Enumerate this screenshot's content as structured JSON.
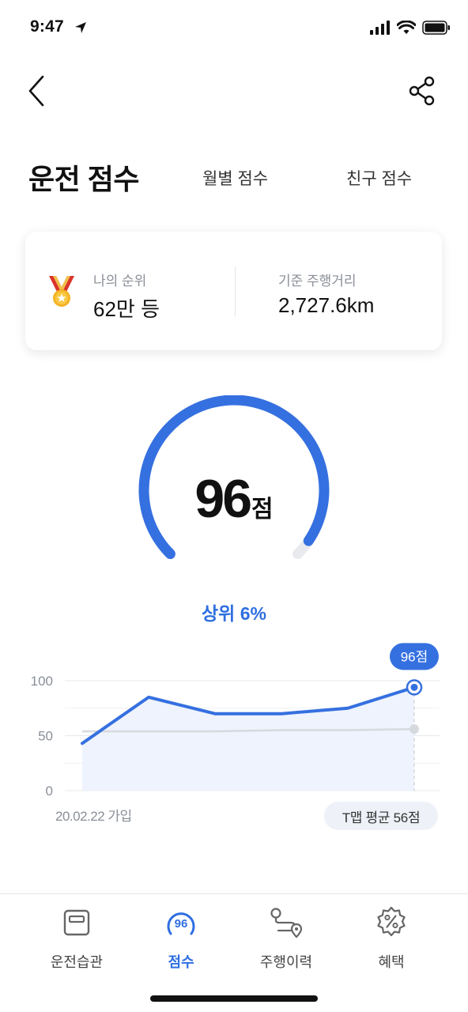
{
  "status": {
    "time": "9:47"
  },
  "tabs": {
    "active": "운전 점수",
    "monthly": "월별 점수",
    "friends": "친구 점수"
  },
  "rank_card": {
    "rank_label": "나의 순위",
    "rank_value": "62만 등",
    "distance_label": "기준 주행거리",
    "distance_value": "2,727.6km"
  },
  "score": {
    "value": "96",
    "unit": "점",
    "gauge_fraction": 0.96,
    "rank_percent": "상위 6%"
  },
  "chart_data": {
    "type": "line",
    "ylim": [
      0,
      100
    ],
    "y_ticks": [
      "100",
      "50",
      "0"
    ],
    "series": [
      {
        "values": [
          43,
          85,
          70,
          70,
          75,
          94
        ],
        "color": "#3570e0"
      },
      {
        "values": [
          54,
          54,
          54,
          55,
          55,
          56
        ],
        "color": "#d6d9de"
      }
    ],
    "start_label": "20.02.22 가입",
    "latest_tooltip": "96점",
    "average_label": "T맵 평균 56점"
  },
  "bottom_nav": {
    "items": [
      {
        "label": "운전습관",
        "icon": "driving-habit-icon"
      },
      {
        "label": "점수",
        "icon": "score-badge-icon",
        "badge": "96"
      },
      {
        "label": "주행이력",
        "icon": "route-history-icon"
      },
      {
        "label": "혜택",
        "icon": "discount-badge-icon"
      }
    ]
  },
  "colors": {
    "accent": "#2f6fe0",
    "gauge": "#3570e0",
    "gauge_track": "#e8eaee"
  }
}
